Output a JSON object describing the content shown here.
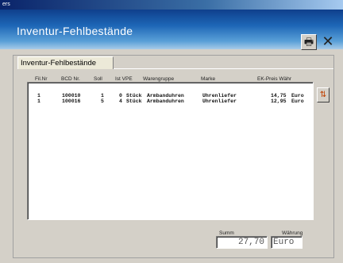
{
  "window": {
    "titlebar_text": "ers"
  },
  "header": {
    "title": "Inventur-Fehlbestände",
    "print_icon": "printer-icon",
    "close_icon": "close-icon"
  },
  "tab": {
    "label": "Inventur-Fehlbestände"
  },
  "table": {
    "columns": [
      "Fil.Nr",
      "BCD Nr.",
      "Soll",
      "Ist VPE",
      "Warengruppe",
      "Marke",
      "EK-Preis Währ"
    ],
    "rows": [
      {
        "fil": "1",
        "bcd": "100010",
        "soll": "1",
        "ist": "0",
        "vpe": "Stück",
        "warengruppe": "Armbanduhren",
        "marke": "Uhrenliefer",
        "ek": "14,75",
        "waehr": "Euro"
      },
      {
        "fil": "1",
        "bcd": "100016",
        "soll": "5",
        "ist": "4",
        "vpe": "Stück",
        "warengruppe": "Armbanduhren",
        "marke": "Uhrenliefer",
        "ek": "12,95",
        "waehr": "Euro"
      }
    ]
  },
  "footer": {
    "summe_label": "Summ",
    "summe_value": "27,70",
    "waehrung_label": "Währung",
    "waehrung_value": "Euro"
  },
  "sort_icon": "sort-icon"
}
